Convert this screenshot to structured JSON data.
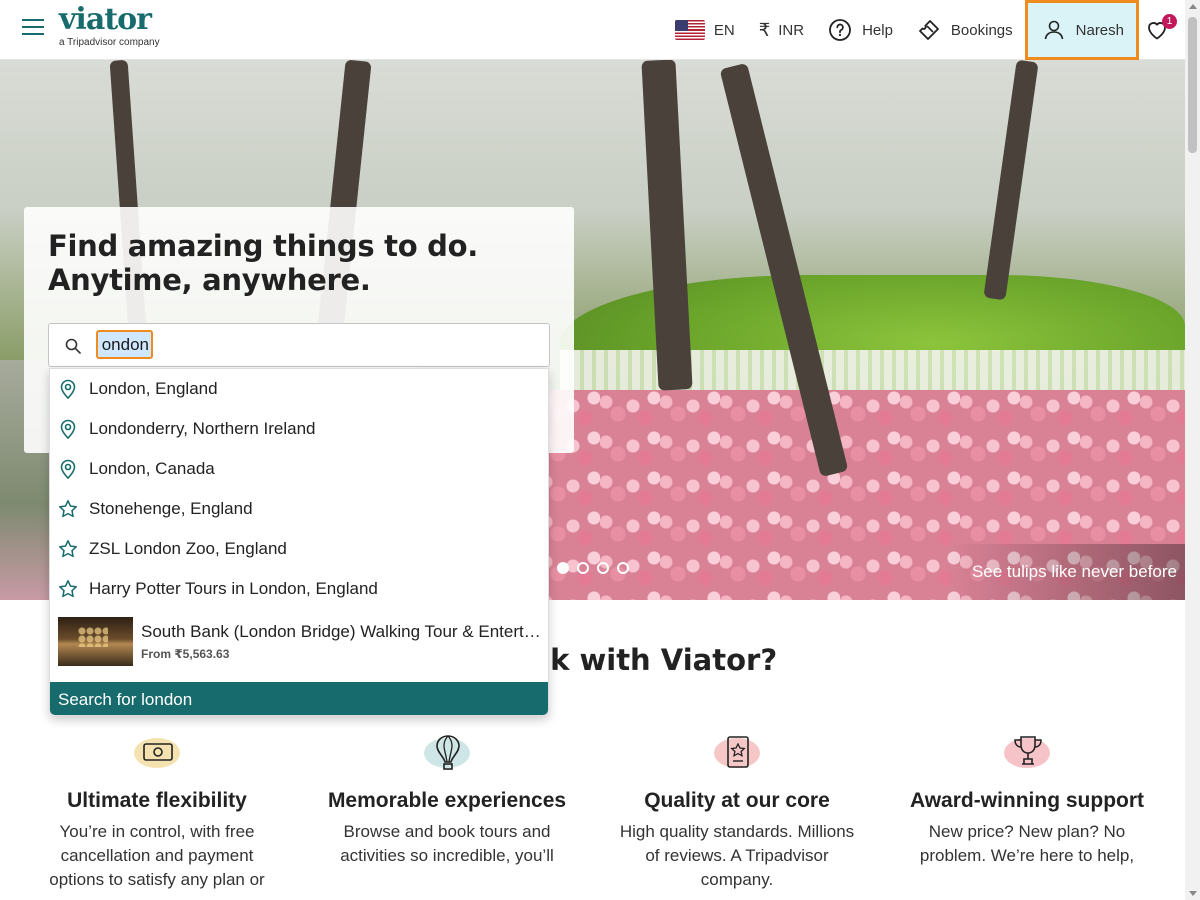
{
  "header": {
    "logo_text": "viator",
    "logo_tagline": "a Tripadvisor company",
    "language": "EN",
    "currency_symbol": "₹",
    "currency": "INR",
    "help": "Help",
    "bookings": "Bookings",
    "user_name": "Naresh",
    "wishlist_count": "1"
  },
  "hero": {
    "heading_line1": "Find amazing things to do.",
    "heading_line2": "Anytime, anywhere.",
    "caption": "See tulips like never before",
    "carousel_active_index": 1,
    "carousel_total": 4
  },
  "search": {
    "value": "london",
    "visible_value": "ondon",
    "suggestions": [
      {
        "label": "London, England",
        "icon": "location-pin-icon"
      },
      {
        "label": "Londonderry, Northern Ireland",
        "icon": "location-pin-icon"
      },
      {
        "label": "London, Canada",
        "icon": "location-pin-icon"
      },
      {
        "label": "Stonehenge, England",
        "icon": "star-icon"
      },
      {
        "label": "ZSL London Zoo, England",
        "icon": "star-icon"
      },
      {
        "label": "Harry Potter Tours in London, England",
        "icon": "star-icon"
      }
    ],
    "product": {
      "title": "South Bank (London Bridge) Walking Tour & Entertainment",
      "price": "From ₹5,563.63"
    },
    "search_for_label": "Search for london"
  },
  "why": {
    "title": "Why book with Viator?",
    "features": [
      {
        "title": "Ultimate flexibility",
        "desc": "You’re in control, with free cancellation and payment options to satisfy any plan or",
        "icon": "money-icon",
        "color": "#f4e2b0"
      },
      {
        "title": "Memorable experiences",
        "desc": "Browse and book tours and activities so incredible, you’ll",
        "icon": "hot-air-balloon-icon",
        "color": "#cfe6e6"
      },
      {
        "title": "Quality at our core",
        "desc": "High quality standards. Millions of reviews. A Tripadvisor company.",
        "icon": "badge-star-icon",
        "color": "#f6c7c7"
      },
      {
        "title": "Award-winning support",
        "desc": "New price? New plan? No problem. We’re here to help,",
        "icon": "trophy-icon",
        "color": "#f6c3c8"
      }
    ]
  },
  "colors": {
    "brand": "#186b6d",
    "focus": "#f08c1e",
    "badge": "#c2185b"
  }
}
